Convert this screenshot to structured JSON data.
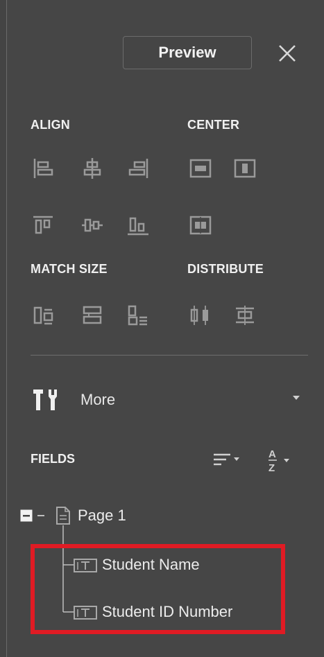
{
  "header": {
    "preview_label": "Preview"
  },
  "align": {
    "title": "ALIGN"
  },
  "center": {
    "title": "CENTER"
  },
  "match_size": {
    "title": "MATCH SIZE"
  },
  "distribute": {
    "title": "DISTRIBUTE"
  },
  "more": {
    "label": "More"
  },
  "fields": {
    "title": "FIELDS",
    "tree": {
      "page_label": "Page 1",
      "children": [
        {
          "label": "Student Name"
        },
        {
          "label": "Student ID Number"
        }
      ]
    }
  },
  "colors": {
    "highlight": "#e01b24",
    "panel": "#464646"
  }
}
